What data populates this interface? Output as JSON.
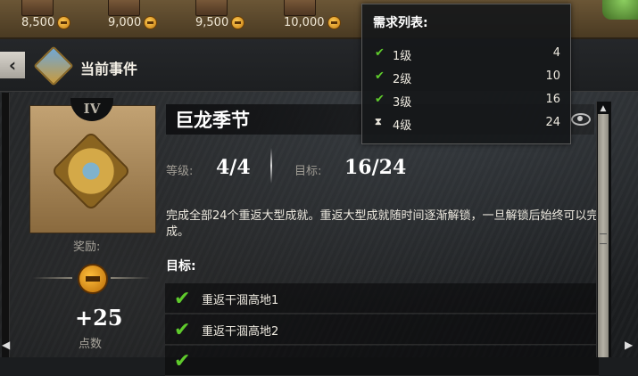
{
  "costs": [
    {
      "value": "8,500",
      "icon": "coin-icon"
    },
    {
      "value": "9,000",
      "icon": "coin-icon"
    },
    {
      "value": "9,500",
      "icon": "coin-icon"
    },
    {
      "value": "10,000",
      "icon": "coin-icon"
    }
  ],
  "header": {
    "title": "当前事件",
    "back_icon": "‹"
  },
  "card": {
    "tier": "IV"
  },
  "reward": {
    "label": "奖励:",
    "value": "+25",
    "unit": "点数"
  },
  "event": {
    "title": "巨龙季节",
    "level_label": "等级:",
    "level_value": "4/4",
    "target_label": "目标:",
    "target_value": "16/24",
    "description": "完成全部24个重返大型成就。重返大型成就随时间逐渐解锁，一旦解锁后始终可以完成。",
    "goals_heading": "目标:",
    "goals": [
      {
        "label": "重返干涸高地1",
        "done": true
      },
      {
        "label": "重返干涸高地2",
        "done": true
      },
      {
        "label": "",
        "done": true
      }
    ]
  },
  "tooltip": {
    "title": "需求列表:",
    "rows": [
      {
        "level": "1级",
        "count": "4",
        "status": "done"
      },
      {
        "level": "2级",
        "count": "10",
        "status": "done"
      },
      {
        "level": "3级",
        "count": "16",
        "status": "done"
      },
      {
        "level": "4级",
        "count": "24",
        "status": "pending"
      }
    ]
  },
  "colors": {
    "check_green": "#5fcb2c",
    "coin_gold": "#ffbe3b"
  }
}
